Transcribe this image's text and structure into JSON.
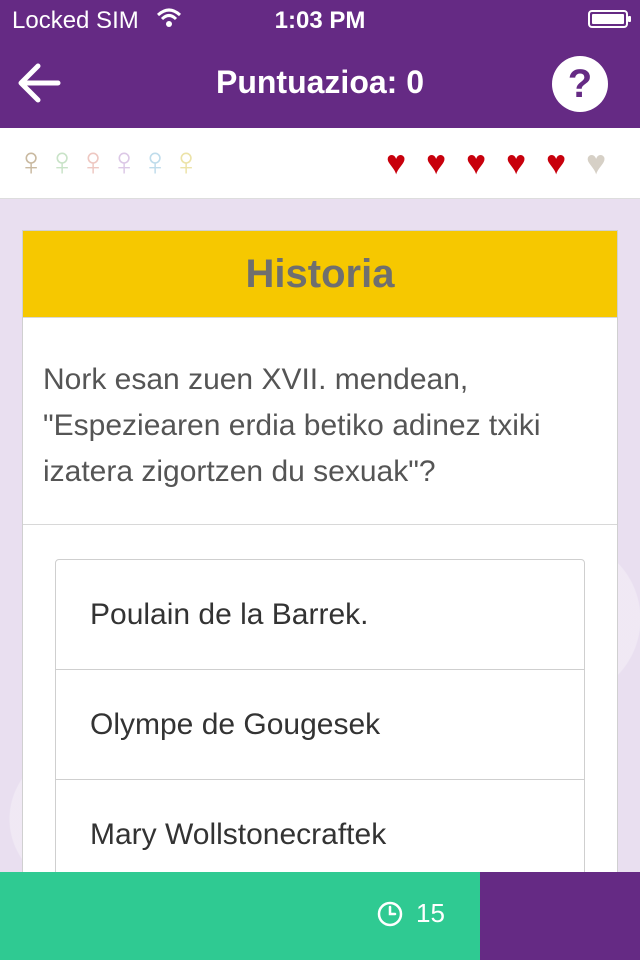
{
  "status_bar": {
    "carrier": "Locked SIM",
    "time": "1:03 PM"
  },
  "header": {
    "score_label": "Puntuazioa: 0",
    "help_label": "?"
  },
  "progress": {
    "venus_symbols": [
      {
        "glyph": "♀",
        "color": "#c9b9a0"
      },
      {
        "glyph": "♀",
        "color": "#c9e3c8"
      },
      {
        "glyph": "♀",
        "color": "#eec8c2"
      },
      {
        "glyph": "♀",
        "color": "#dcc8e6"
      },
      {
        "glyph": "♀",
        "color": "#bfdceb"
      },
      {
        "glyph": "♀",
        "color": "#ece3a8"
      }
    ],
    "lives_total": 6,
    "lives_remaining": 5,
    "heart_glyph": "♥"
  },
  "card": {
    "category": "Historia",
    "question": "Nork esan zuen XVII. mendean, \"Espeziearen erdia betiko adinez txiki izatera zigortzen du sexuak\"?",
    "answers": [
      "Poulain de la Barrek.",
      "Olympe de Gougesek",
      "Mary Wollstonecraftek"
    ]
  },
  "footer": {
    "timer_value": "15"
  },
  "colors": {
    "brand_purple": "#652a84",
    "category_yellow": "#f6c800",
    "timer_green": "#2fca92",
    "heart_red": "#c8000c"
  }
}
